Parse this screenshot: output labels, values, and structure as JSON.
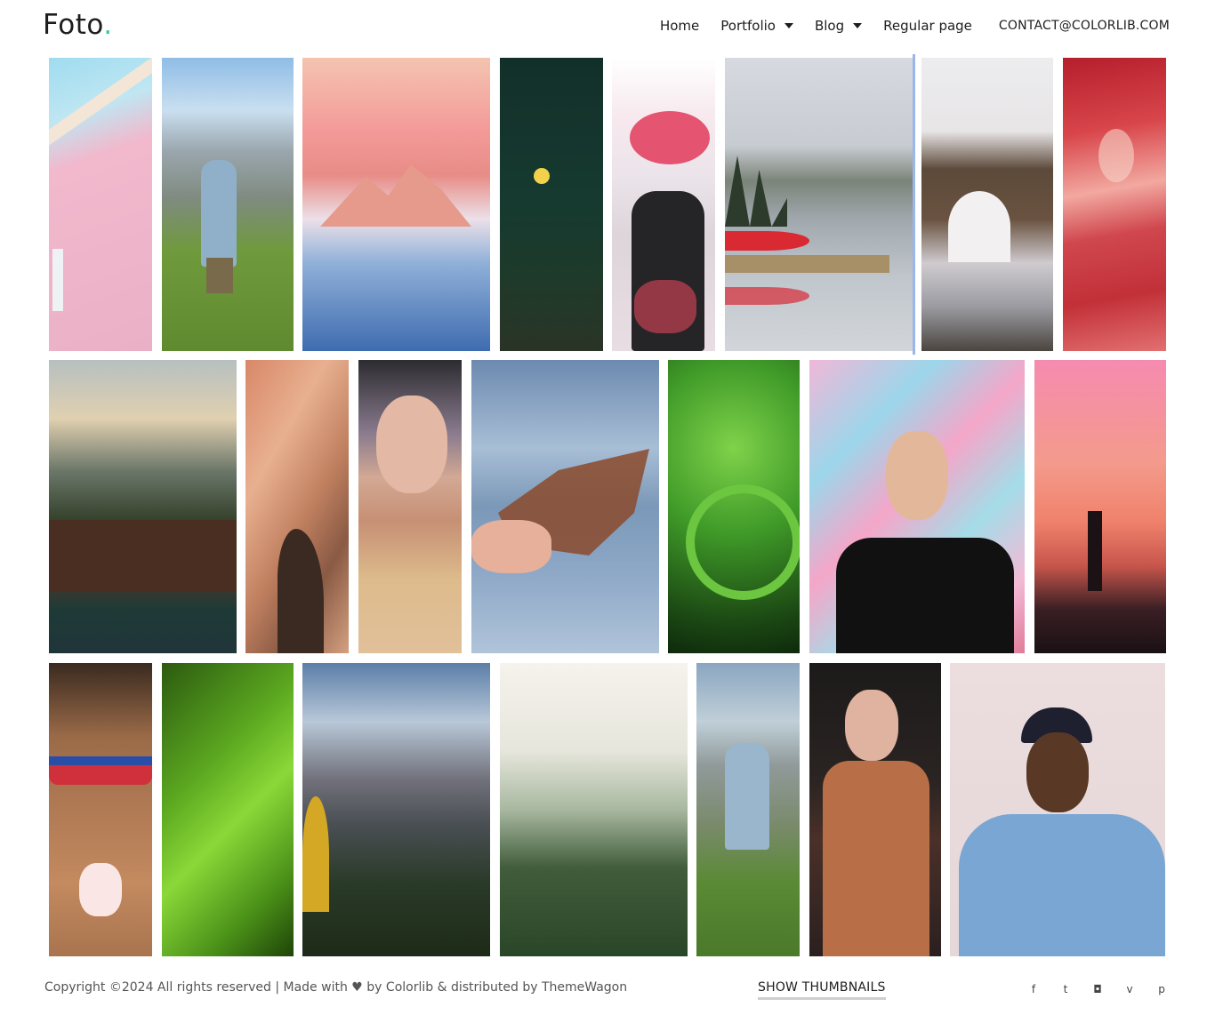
{
  "header": {
    "logo_text": "Foto",
    "logo_dot": ".",
    "nav": [
      {
        "label": "Home",
        "dropdown": false
      },
      {
        "label": "Portfolio",
        "dropdown": true
      },
      {
        "label": "Blog",
        "dropdown": true
      },
      {
        "label": "Regular page",
        "dropdown": false
      }
    ],
    "contact": "CONTACT@COLORLIB.COM"
  },
  "footer": {
    "copyright_pre": "Copyright ©2024 All rights reserved | Made with",
    "heart_icon": "♥",
    "copyright_post": "by Colorlib & distributed by ThemeWagon",
    "show_thumbnails": "SHOW THUMBNAILS",
    "social": [
      {
        "icon": "facebook-icon",
        "glyph": "f"
      },
      {
        "icon": "twitter-icon",
        "glyph": "t"
      },
      {
        "icon": "instagram-icon",
        "glyph": "◘"
      },
      {
        "icon": "vimeo-icon",
        "glyph": "v"
      },
      {
        "icon": "pinterest-icon",
        "glyph": "p"
      }
    ]
  },
  "colors": {
    "accent": "#2bd08e",
    "divider": "#9ab6ea"
  }
}
